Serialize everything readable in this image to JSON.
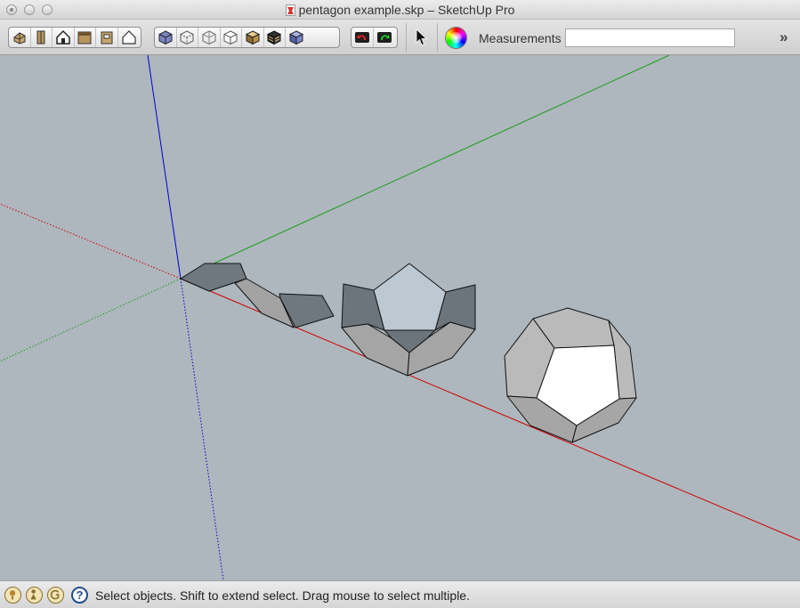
{
  "window": {
    "title": "pentagon example.skp – SketchUp Pro"
  },
  "toolbar": {
    "measurements_label": "Measurements",
    "measurements_value": "",
    "overflow_glyph": "»",
    "views": [
      "iso-view",
      "top-view",
      "front-view",
      "right-view",
      "back-view",
      "left-view"
    ],
    "styles": [
      "xray-style",
      "back-edges-style",
      "wireframe-style",
      "hidden-line-style",
      "shaded-style",
      "shaded-with-textures-style",
      "monochrome-style"
    ],
    "actions": [
      "undo",
      "redo",
      "select-tool",
      "color-wheel"
    ]
  },
  "statusbar": {
    "message": "Select objects. Shift to extend select. Drag mouse to select multiple.",
    "help_glyph": "?"
  },
  "colors": {
    "viewport_bg": "#aeb7bd",
    "axis_red": "#cc0000",
    "axis_green": "#1a9a1a",
    "axis_blue": "#0000cc"
  }
}
